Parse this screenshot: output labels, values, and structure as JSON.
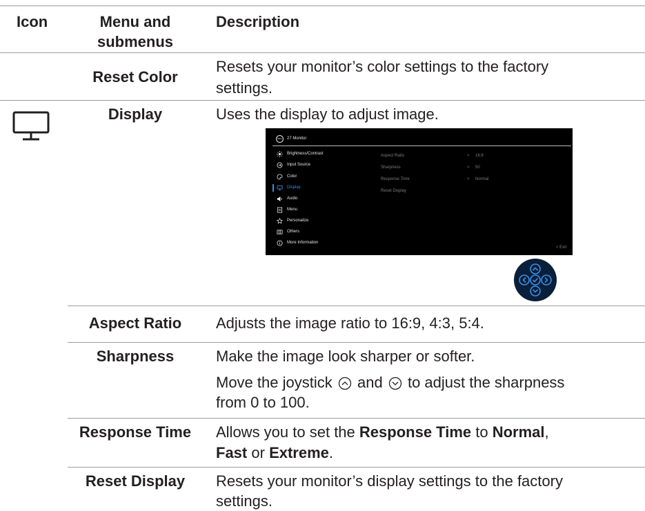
{
  "headers": {
    "icon": "Icon",
    "menu_line1": "Menu and",
    "menu_line2": "submenus",
    "description": "Description"
  },
  "reset_color": {
    "name": "Reset Color",
    "desc_line1": "Resets your monitor’s color settings to the factory",
    "desc_line2": "settings."
  },
  "display": {
    "icon": "monitor-icon",
    "name": "Display",
    "desc": "Uses the display to adjust image."
  },
  "osd": {
    "logo": "DELL",
    "title": "27 Monitor",
    "menu_items": [
      {
        "label": "Brightness/Contrast",
        "icon": "brightness-icon"
      },
      {
        "label": "Input Source",
        "icon": "input-source-icon"
      },
      {
        "label": "Color",
        "icon": "color-icon"
      },
      {
        "label": "Display",
        "icon": "display-icon",
        "selected": true
      },
      {
        "label": "Audio",
        "icon": "audio-icon"
      },
      {
        "label": "Menu",
        "icon": "menu-icon"
      },
      {
        "label": "Personalize",
        "icon": "star-icon"
      },
      {
        "label": "Others",
        "icon": "others-icon"
      },
      {
        "label": "More Information",
        "icon": "info-icon"
      }
    ],
    "settings": [
      {
        "label": "Aspect Ratio",
        "arrow": ">",
        "value": "16:9"
      },
      {
        "label": "Sharpness",
        "arrow": ">",
        "value": "50"
      },
      {
        "label": "Response Time",
        "arrow": ">",
        "value": "Normal"
      },
      {
        "label": "Reset Display",
        "arrow": "",
        "value": ""
      }
    ],
    "exit": "< Exit"
  },
  "joystick": {
    "icon": "joystick-icon"
  },
  "aspect_ratio": {
    "name": "Aspect Ratio",
    "desc": "Adjusts the image ratio to 16:9, 4:3, 5:4."
  },
  "sharpness": {
    "name": "Sharpness",
    "desc1": "Make the image look sharper or softer.",
    "desc2_a": "Move the joystick",
    "desc2_b": "and",
    "desc2_c": "to adjust the sharpness",
    "desc2_line2": "from 0 to 100."
  },
  "response_time": {
    "name": "Response Time",
    "d_a": "Allows you to set the",
    "d_b": "Response Time",
    "d_c": "to",
    "d_d": "Normal",
    "d_e": ",",
    "d_f": "Fast",
    "d_g": "or",
    "d_h": "Extreme",
    "d_i": "."
  },
  "reset_display": {
    "name": "Reset Display",
    "desc_line1": "Resets your monitor’s display settings to the factory",
    "desc_line2": "settings."
  }
}
